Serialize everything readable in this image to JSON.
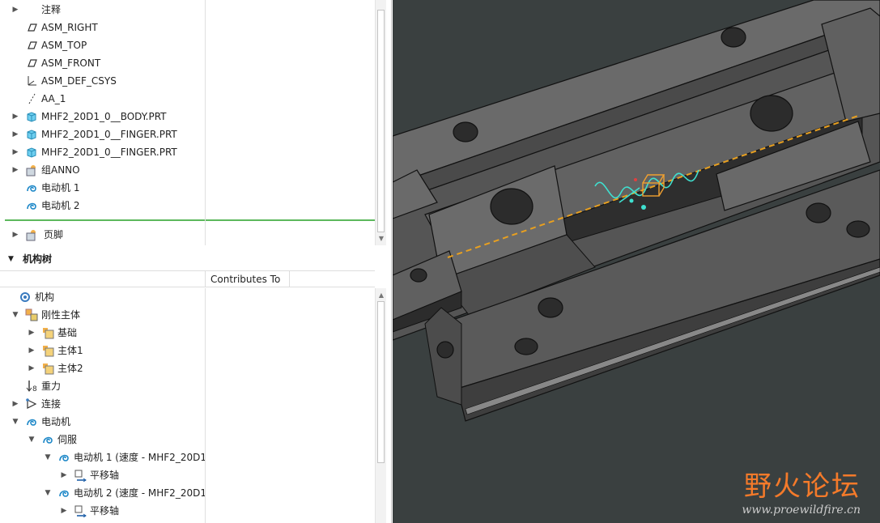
{
  "model_tree": {
    "items": [
      {
        "label": "注释",
        "expander": "▶",
        "icon": "annotation-icon"
      },
      {
        "label": "ASM_RIGHT",
        "expander": "",
        "icon": "datum-plane-icon"
      },
      {
        "label": "ASM_TOP",
        "expander": "",
        "icon": "datum-plane-icon"
      },
      {
        "label": "ASM_FRONT",
        "expander": "",
        "icon": "datum-plane-icon"
      },
      {
        "label": "ASM_DEF_CSYS",
        "expander": "",
        "icon": "csys-icon"
      },
      {
        "label": "AA_1",
        "expander": "",
        "icon": "datum-axis-icon"
      },
      {
        "label": "MHF2_20D1_0__BODY.PRT",
        "expander": "▶",
        "icon": "part-icon"
      },
      {
        "label": "MHF2_20D1_0__FINGER.PRT",
        "expander": "▶",
        "icon": "part-icon"
      },
      {
        "label": "MHF2_20D1_0__FINGER.PRT",
        "expander": "▶",
        "icon": "part-icon"
      },
      {
        "label": "组ANNO",
        "expander": "▶",
        "icon": "group-icon"
      },
      {
        "label": "电动机 1",
        "expander": "",
        "icon": "motor-icon"
      },
      {
        "label": "电动机 2",
        "expander": "",
        "icon": "motor-icon"
      }
    ],
    "footer": {
      "label": "页脚",
      "expander": "▶",
      "icon": "group-icon"
    }
  },
  "mechanism_section": {
    "title": "机构树",
    "expander": "▼",
    "column_header": "Contributes To"
  },
  "mechanism_tree": {
    "items": [
      {
        "label": "机构",
        "expander": "",
        "icon": "mechanism-icon",
        "level": 0
      },
      {
        "label": "刚性主体",
        "expander": "▼",
        "icon": "rigid-body-icon",
        "level": 1
      },
      {
        "label": "基础",
        "expander": "▶",
        "icon": "body-icon",
        "level": 2
      },
      {
        "label": "主体1",
        "expander": "▶",
        "icon": "body-icon",
        "level": 2
      },
      {
        "label": "主体2",
        "expander": "▶",
        "icon": "body-icon",
        "level": 2
      },
      {
        "label": "重力",
        "expander": "",
        "icon": "gravity-icon",
        "level": 1
      },
      {
        "label": "连接",
        "expander": "▶",
        "icon": "connection-icon",
        "level": 1
      },
      {
        "label": "电动机",
        "expander": "▼",
        "icon": "motor-icon",
        "level": 1
      },
      {
        "label": "伺服",
        "expander": "▼",
        "icon": "motor-icon",
        "level": 2
      },
      {
        "label": "电动机 1 (速度 - MHF2_20D1",
        "expander": "▼",
        "icon": "motor-icon",
        "level": 3
      },
      {
        "label": "平移轴",
        "expander": "▶",
        "icon": "translation-axis-icon",
        "level": 4
      },
      {
        "label": "电动机 2 (速度 - MHF2_20D1",
        "expander": "▼",
        "icon": "motor-icon",
        "level": 3
      },
      {
        "label": "平移轴",
        "expander": "▶",
        "icon": "translation-axis-icon",
        "level": 4
      }
    ]
  },
  "watermark": {
    "title": "野火论坛",
    "url": "www.proewildfire.cn"
  },
  "colors": {
    "viewport_bg": "#3a4040",
    "part_gray": "#5c5c5c",
    "edge": "#111111",
    "motor_cyan": "#3fe0d0",
    "dashed_orange": "#e8a020",
    "selection_box": "#f0a030",
    "tree_separator": "#5cb85c",
    "watermark_orange": "#f47a2a"
  }
}
